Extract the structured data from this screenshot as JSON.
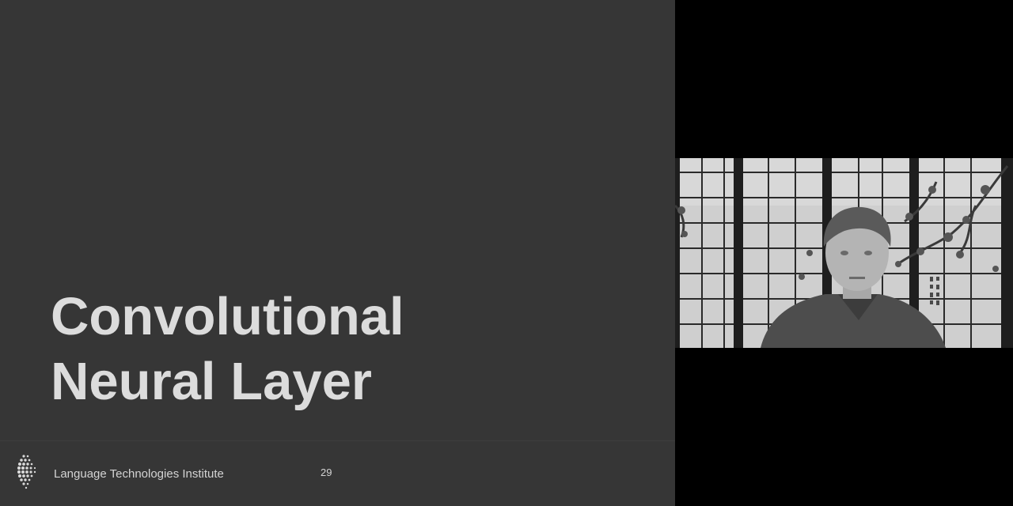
{
  "slide": {
    "title_line1": "Convolutional",
    "title_line2": "Neural Layer",
    "footer_org": "Language Technologies Institute",
    "page_number": "29",
    "logo_icon": "lti-dot-pattern-logo-icon"
  },
  "video": {
    "participant_icon": "webcam-participant-icon",
    "tint": "grayscale"
  },
  "colors": {
    "slide_background": "#363636",
    "slide_text": "#dcdcdc",
    "screen_background": "#000000"
  }
}
